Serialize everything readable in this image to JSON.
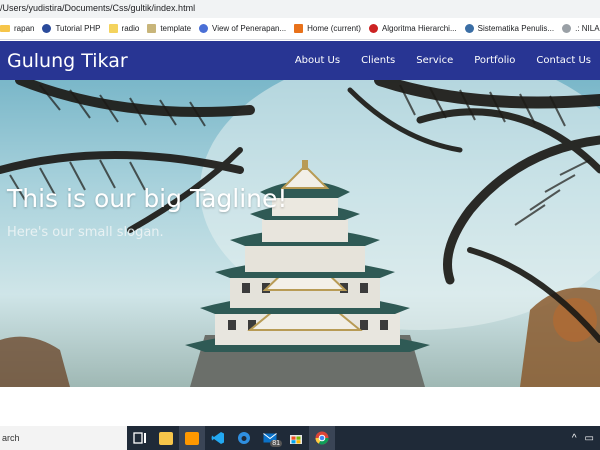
{
  "browser": {
    "url": "/Users/yudistira/Documents/Css/gultik/index.html",
    "bookmarks": [
      {
        "label": "rapan",
        "icon": "folder-icon"
      },
      {
        "label": "Tutorial PHP",
        "icon": "php-icon"
      },
      {
        "label": "radio",
        "icon": "radio-icon"
      },
      {
        "label": "template",
        "icon": "template-icon"
      },
      {
        "label": "View of Penerapan...",
        "icon": "document-icon"
      },
      {
        "label": "Home (current)",
        "icon": "home-icon"
      },
      {
        "label": "Algoritma Hierarchi...",
        "icon": "info-icon"
      },
      {
        "label": "Sistematika Penulis...",
        "icon": "wordpress-icon"
      },
      {
        "label": ".: NILAI MAH",
        "icon": "globe-icon"
      }
    ]
  },
  "site": {
    "brand": "Gulung Tikar",
    "menu": [
      "About Us",
      "Clients",
      "Service",
      "Portfolio",
      "Contact Us"
    ],
    "tagline": "This is our big Tagline!",
    "slogan": "Here's our small slogan."
  },
  "taskbar": {
    "search_text": "arch",
    "apps": [
      "task-view",
      "file-explorer",
      "sublime-text",
      "vscode",
      "edge",
      "mail",
      "store",
      "chrome"
    ],
    "mail_badge": "81"
  },
  "colors": {
    "navbar": "#283593",
    "taskbar": "#1f2a38"
  }
}
